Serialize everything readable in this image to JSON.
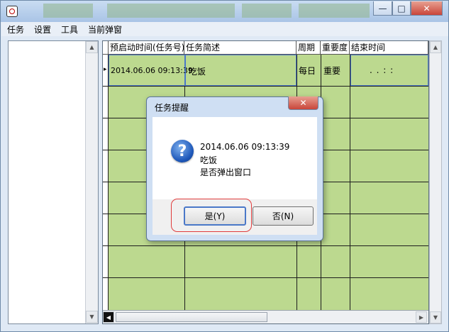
{
  "window": {
    "controls": {
      "minimize": "—",
      "maximize": "□",
      "close": "✕"
    }
  },
  "menu": [
    "任务",
    "设置",
    "工具",
    "当前弹窗"
  ],
  "grid": {
    "columns": [
      "预启动时间(任务号)",
      "任务简述",
      "周期",
      "重要度",
      "结束时间"
    ],
    "rows": [
      {
        "marker": "▸",
        "start_time": "2014.06.06 09:13:39",
        "desc": "吃饭",
        "period": "每日",
        "importance": "重要",
        "end_time": ".     .     :  :"
      }
    ]
  },
  "dialog": {
    "title": "任务提醒",
    "close": "✕",
    "icon": "question-icon",
    "message_time": "2014.06.06 09:13:39",
    "message_task": "吃饭",
    "message_question": "是否弹出窗口",
    "yes_label": "是(Y)",
    "no_label": "否(N)"
  },
  "colors": {
    "grid_bg": "#bcd98f",
    "highlight": "#e03c3c"
  }
}
